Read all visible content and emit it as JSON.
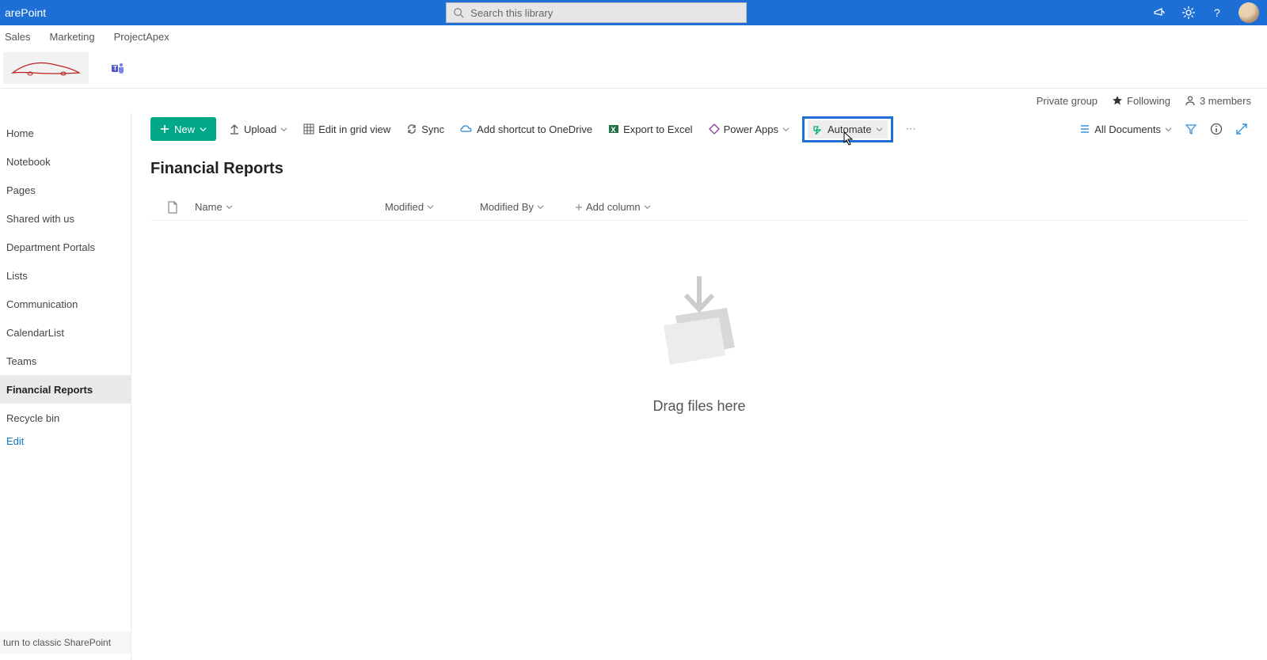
{
  "header": {
    "app_name": "arePoint",
    "search_placeholder": "Search this library"
  },
  "top_tabs": [
    "Sales",
    "Marketing",
    "ProjectApex"
  ],
  "info_row": {
    "private": "Private group",
    "following": "Following",
    "members": "3 members"
  },
  "sidebar": {
    "items": [
      "Home",
      "Notebook",
      "Pages",
      "Shared with us",
      "Department Portals",
      "Lists",
      "Communication",
      "CalendarList",
      "Teams",
      "Financial Reports",
      "Recycle bin"
    ],
    "active_index": 9,
    "edit": "Edit",
    "classic": "turn to classic SharePoint"
  },
  "cmdbar": {
    "new": "New",
    "upload": "Upload",
    "grid": "Edit in grid view",
    "sync": "Sync",
    "shortcut": "Add shortcut to OneDrive",
    "export": "Export to Excel",
    "powerapps": "Power Apps",
    "automate": "Automate",
    "view": "All Documents"
  },
  "library": {
    "title": "Financial Reports",
    "columns": {
      "name": "Name",
      "modified": "Modified",
      "modified_by": "Modified By",
      "add": "Add column"
    },
    "empty_text": "Drag files here"
  }
}
